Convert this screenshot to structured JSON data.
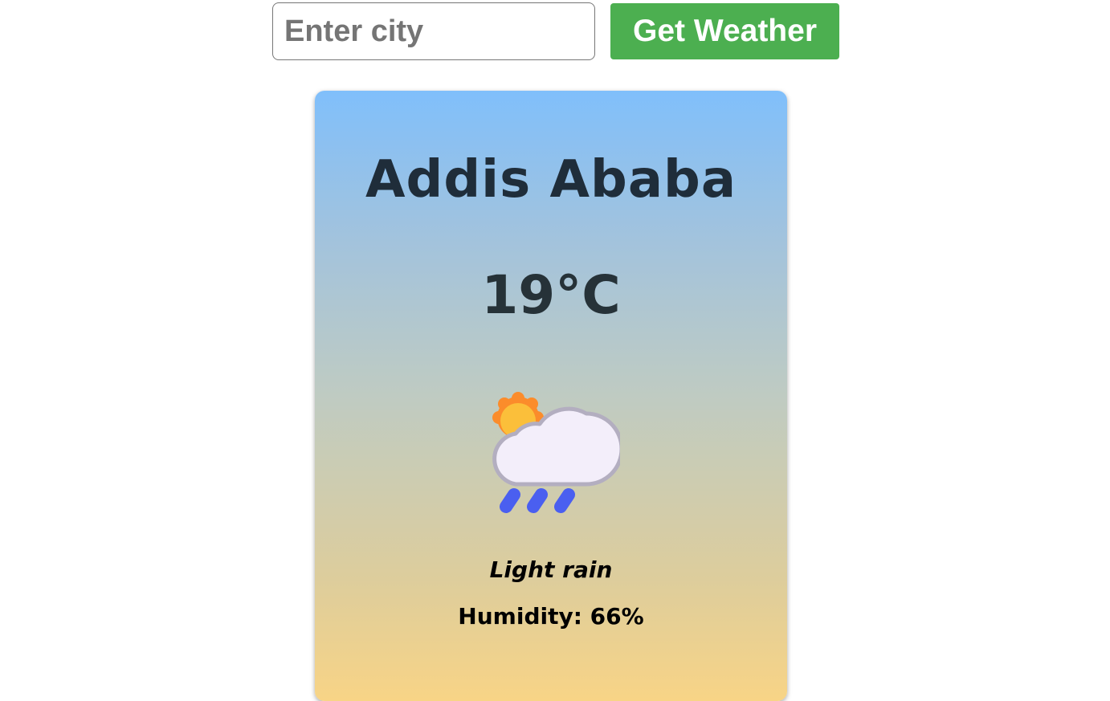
{
  "search": {
    "placeholder": "Enter city",
    "value": "",
    "button_label": "Get Weather"
  },
  "weather": {
    "city": "Addis Ababa",
    "temperature": "19°C",
    "icon": "partly-cloudy-rain-icon",
    "description": "Light rain",
    "humidity_label": "Humidity:",
    "humidity_value": "66%"
  },
  "colors": {
    "button": "#4caf50",
    "card_gradient_top": "#80bffb",
    "card_gradient_bottom": "#f8d486",
    "city_text": "#1f2d3a",
    "rain_drops": "#4a5ff0"
  }
}
